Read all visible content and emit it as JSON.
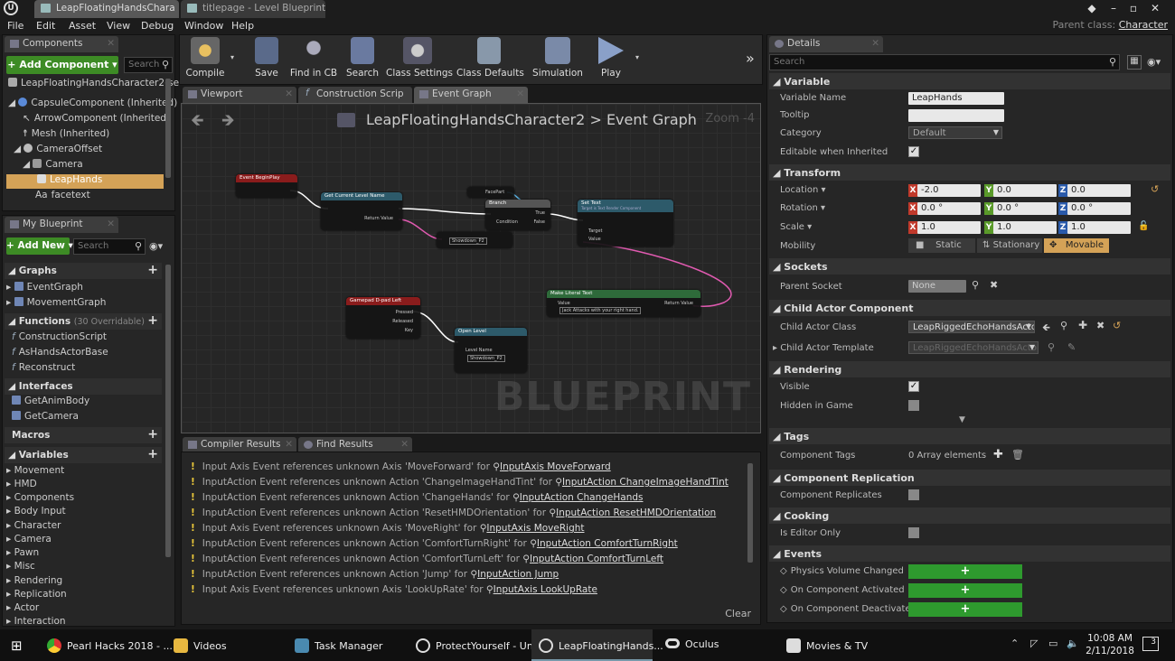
{
  "titlebar": {
    "tabs": [
      "LeapFloatingHandsChara",
      "titlepage - Level Blueprint"
    ],
    "parent_class_label": "Parent class:",
    "parent_class_value": "Character"
  },
  "menu": [
    "File",
    "Edit",
    "Asset",
    "View",
    "Debug",
    "Window",
    "Help"
  ],
  "components": {
    "tab": "Components",
    "add_label": "+ Add Component ▾",
    "search_placeholder": "Search",
    "tree": [
      "LeapFloatingHandsCharacter2(se",
      "CapsuleComponent (Inherited)",
      "ArrowComponent (Inherited)",
      "Mesh (Inherited)",
      "CameraOffset",
      "Camera",
      "LeapHands",
      "facetext"
    ]
  },
  "my_blueprint": {
    "tab": "My Blueprint",
    "add_label": "+ Add New ▾",
    "search_placeholder": "Search",
    "graphs_header": "Graphs",
    "graphs": [
      "EventGraph",
      "MovementGraph"
    ],
    "functions_header": "Functions",
    "functions_sub": "(30 Overridable)",
    "functions": [
      "ConstructionScript",
      "AsHandsActorBase",
      "Reconstruct"
    ],
    "interfaces_header": "Interfaces",
    "interfaces": [
      "GetAnimBody",
      "GetCamera"
    ],
    "macros_header": "Macros",
    "variables_header": "Variables",
    "variables": [
      "Movement",
      "HMD",
      "Components",
      "Body Input",
      "Character",
      "Camera",
      "Pawn",
      "Misc",
      "Rendering",
      "Replication",
      "Actor",
      "Interaction"
    ]
  },
  "toolbar": {
    "buttons": [
      "Compile",
      "Save",
      "Find in CB",
      "Search",
      "Class Settings",
      "Class Defaults",
      "Simulation",
      "Play"
    ]
  },
  "graph": {
    "tabs": [
      "Viewport",
      "Construction Scrip",
      "Event Graph"
    ],
    "breadcrumb_parent": "LeapFloatingHandsCharacter2",
    "breadcrumb_sep": ">",
    "breadcrumb_current": "Event Graph",
    "zoom": "Zoom -4",
    "watermark": "BLUEPRINT",
    "nodes": {
      "begin_play": "Event BeginPlay",
      "get_level_name": "Get Current Level Name",
      "get_level_return": "Return Value",
      "branch": "Branch",
      "branch_condition": "Condition",
      "branch_true": "True",
      "branch_false": "False",
      "false_label": "FacePart",
      "set_text": "Set Text",
      "set_text_sub": "Target is Text Render Component",
      "set_text_target": "Target",
      "set_text_value": "Value",
      "equal_value": "Showdown_P2",
      "gamepad": "Gamepad D-pad Left",
      "gamepad_pressed": "Pressed",
      "gamepad_released": "Released",
      "gamepad_key": "Key",
      "open_level": "Open Level",
      "open_level_name": "Level Name",
      "open_level_value": "Showdown_P2",
      "make_literal": "Make Literal Text",
      "make_literal_value": "Value",
      "make_literal_return": "Return Value",
      "make_literal_text": "Jack Attacks with your right hand."
    }
  },
  "results": {
    "tabs": [
      "Compiler Results",
      "Find Results"
    ],
    "messages": [
      {
        "text": "Input Axis Event references unknown Axis 'MoveForward' for",
        "link": "InputAxis MoveForward"
      },
      {
        "text": "InputAction Event references unknown Action 'ChangeImageHandTint' for",
        "link": "InputAction ChangeImageHandTint"
      },
      {
        "text": "InputAction Event references unknown Action 'ChangeHands' for",
        "link": "InputAction ChangeHands"
      },
      {
        "text": "InputAction Event references unknown Action 'ResetHMDOrientation' for",
        "link": "InputAction ResetHMDOrientation"
      },
      {
        "text": "Input Axis Event references unknown Axis 'MoveRight' for",
        "link": "InputAxis MoveRight"
      },
      {
        "text": "InputAction Event references unknown Action 'ComfortTurnRight' for",
        "link": "InputAction ComfortTurnRight"
      },
      {
        "text": "InputAction Event references unknown Action 'ComfortTurnLeft' for",
        "link": "InputAction ComfortTurnLeft"
      },
      {
        "text": "InputAction Event references unknown Action 'Jump' for",
        "link": "InputAction Jump"
      },
      {
        "text": "Input Axis Event references unknown Axis 'LookUpRate' for",
        "link": "InputAxis LookUpRate"
      }
    ],
    "clear_label": "Clear"
  },
  "details": {
    "tab": "Details",
    "search_placeholder": "Search",
    "variable": {
      "header": "Variable",
      "name_label": "Variable Name",
      "name_value": "LeapHands",
      "tooltip_label": "Tooltip",
      "tooltip_value": "",
      "category_label": "Category",
      "category_value": "Default",
      "editable_label": "Editable when Inherited"
    },
    "transform": {
      "header": "Transform",
      "location_label": "Location ▾",
      "location": [
        "-2.0",
        "0.0",
        "0.0"
      ],
      "rotation_label": "Rotation ▾",
      "rotation": [
        "0.0 °",
        "0.0 °",
        "0.0 °"
      ],
      "scale_label": "Scale ▾",
      "scale": [
        "1.0",
        "1.0",
        "1.0"
      ],
      "mobility_label": "Mobility",
      "mobility_options": [
        "Static",
        "Stationary",
        "Movable"
      ]
    },
    "sockets": {
      "header": "Sockets",
      "parent_label": "Parent Socket",
      "parent_value": "None"
    },
    "child_actor": {
      "header": "Child Actor Component",
      "class_label": "Child Actor Class",
      "class_value": "LeapRiggedEchoHandsActor2",
      "template_label": "Child Actor Template",
      "template_value": "LeapRiggedEchoHandsActor2-1"
    },
    "rendering": {
      "header": "Rendering",
      "visible_label": "Visible",
      "hidden_label": "Hidden in Game"
    },
    "tags": {
      "header": "Tags",
      "label": "Component Tags",
      "value": "0 Array elements"
    },
    "replication": {
      "header": "Component Replication",
      "label": "Component Replicates"
    },
    "cooking": {
      "header": "Cooking",
      "label": "Is Editor Only"
    },
    "events": {
      "header": "Events",
      "items": [
        "Physics Volume Changed",
        "On Component Activated",
        "On Component Deactivated"
      ],
      "add_symbol": "+"
    }
  },
  "taskbar": {
    "items": [
      "Pearl Hacks 2018 - ...",
      "Videos",
      "Task Manager",
      "ProtectYourself - Un...",
      "LeapFloatingHands...",
      "Oculus",
      "Movies & TV"
    ],
    "time": "10:08 AM",
    "date": "2/11/2018",
    "notifications": "3"
  },
  "colors": {
    "accent_orange": "#d4a257",
    "add_green": "#3d8b25",
    "warning_yellow": "#e8c63a"
  }
}
